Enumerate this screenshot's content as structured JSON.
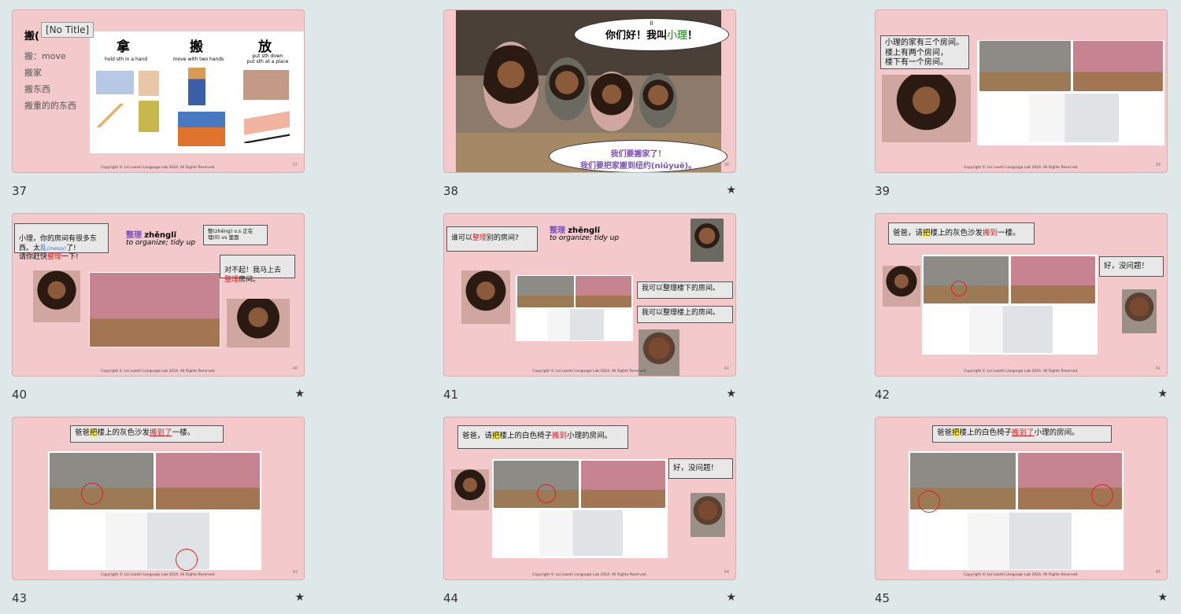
{
  "tooltip": "[No Title]",
  "copyright": "Copyright © Lai Laoshi Language Lab 2024. All Rights Reserved.",
  "star_icon": "★",
  "slides": [
    {
      "num": "37",
      "snum": "37",
      "title": "搬(",
      "lines": [
        "搬：move",
        "搬家",
        "搬东西",
        "搬重的的东西"
      ],
      "cols": [
        {
          "char": "拿",
          "desc": "hold sth in a hand"
        },
        {
          "char": "搬",
          "desc": "move with two hands"
        },
        {
          "char": "放",
          "desc": "put sth down\nput sth at a place"
        }
      ]
    },
    {
      "num": "38",
      "snum": "38",
      "top_small": "lǐ",
      "top_a": "你们好！我叫",
      "top_b": "小理",
      "top_c": "！",
      "bottom_1": "我们要搬家了！",
      "bottom_2": "我们要把家搬到纽约(niǔyuē)。"
    },
    {
      "num": "39",
      "snum": "39",
      "bubble": "小理的家有三个房间。\n楼上有两个房间，\n楼下有一个房间。"
    },
    {
      "num": "40",
      "snum": "40",
      "b1a": "小理，你的房间有很多东西。太",
      "b1b": "乱",
      "b1c": "(messy)",
      "b1d": "了!\n请你赶快",
      "b1e": "整理",
      "b1f": "一下!",
      "word": "整理",
      "pinyin": "zhěnglǐ",
      "meaning": "to organize; tidy up",
      "note": "整(zhěng)  v.s   正在\n理(lǐ)   vs    里面",
      "b2a": "对不起！我马上去\n",
      "b2b": "整理",
      "b2c": "房间。"
    },
    {
      "num": "41",
      "snum": "41",
      "b1a": "谁可以",
      "b1b": "整理",
      "b1c": "别的房间?",
      "word": "整理",
      "pinyin": "zhěnglǐ",
      "meaning": "to organize; tidy up",
      "b2": "我可以整理楼下的房间。",
      "b3": "我可以整理楼上的房间。"
    },
    {
      "num": "42",
      "snum": "42",
      "b1a": "爸爸，请",
      "b1b": "把",
      "b1c": "楼上的灰色沙发",
      "b1d": "搬到",
      "b1e": "一楼。",
      "b2": "好，没问题！"
    },
    {
      "num": "43",
      "snum": "43",
      "b1a": "爸爸",
      "b1b": "把",
      "b1c": "楼上的灰色沙发",
      "b1d": "搬到了",
      "b1e": "一楼。"
    },
    {
      "num": "44",
      "snum": "44",
      "b1a": "爸爸，请",
      "b1b": "把",
      "b1c": "楼上的白色椅子",
      "b1d": "搬到",
      "b1e": "小理的房间。",
      "b2": "好，没问题！"
    },
    {
      "num": "45",
      "snum": "45",
      "b1a": "爸爸",
      "b1b": "把",
      "b1c": "楼上的白色椅子",
      "b1d": "搬到了",
      "b1e": "小理的房间。"
    }
  ]
}
